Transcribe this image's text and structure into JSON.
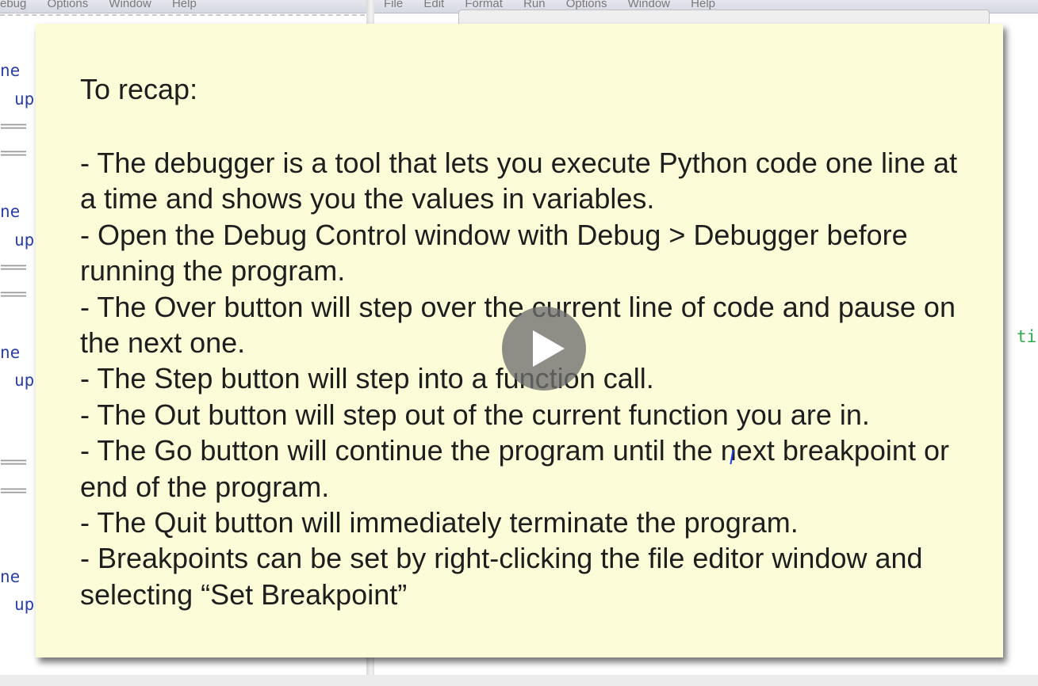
{
  "left_window": {
    "menu": [
      "ebug",
      "Options",
      "Window",
      "Help"
    ],
    "code_fragments": [
      "ne",
      "up",
      "ne",
      "up",
      "ne",
      "up",
      "ne",
      "up"
    ],
    "separator": "==="
  },
  "right_window": {
    "menu": [
      "File",
      "Edit",
      "Format",
      "Run",
      "Options",
      "Window",
      "Help"
    ],
    "code_fragment": "ti"
  },
  "slide": {
    "title": "To recap:",
    "points": [
      "-  The debugger is a tool that lets you execute Python code one line at a time and shows you the values in variables.",
      "- Open the Debug Control window with Debug > Debugger before running the program.",
      "- The Over button will step over the current line of code and pause on the next one.",
      "- The Step button will step into a function call.",
      "- The Out button will step out of the current function you are in.",
      "- The Go button will continue the program until the next breakpoint or end of the program.",
      "- The Quit button will immediately terminate the program.",
      "- Breakpoints can be set by right-clicking the file editor window and selecting “Set Breakpoint”"
    ]
  },
  "video": {
    "play_icon": "play-icon"
  },
  "colors": {
    "slide_background": "#fcfdd8",
    "code_blue": "#2b3fa6",
    "code_green": "#2ea84a"
  }
}
